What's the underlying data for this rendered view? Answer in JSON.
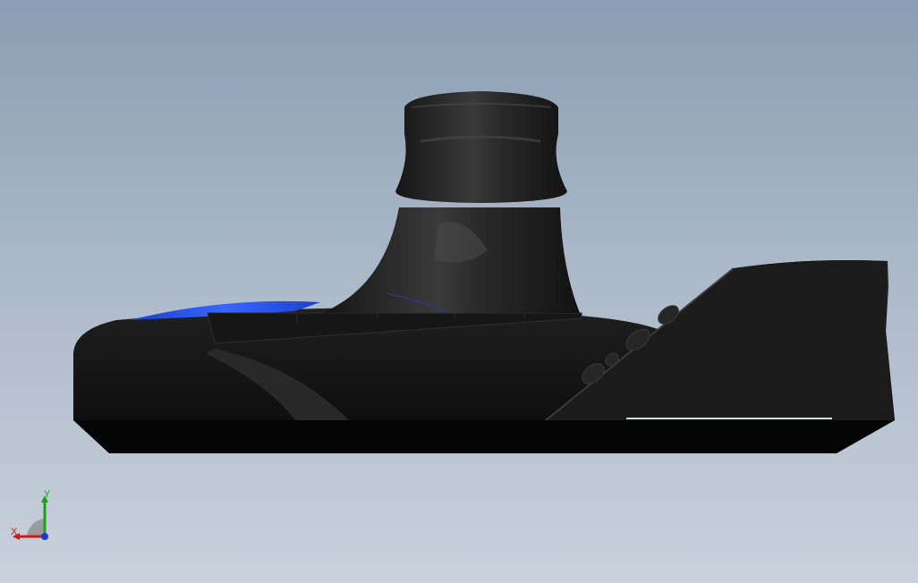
{
  "viewport": {
    "background_top": "#8a9db2",
    "background_bottom": "#c9d1dc"
  },
  "model": {
    "body_color": "#1c1c1c",
    "highlight_color": "#3a3a3a",
    "accent_color": "#1f4fe0"
  },
  "triad": {
    "x_label": "X",
    "y_label": "Y",
    "x_color": "#d01818",
    "y_color": "#1aa21a",
    "z_color": "#1a3ad0"
  }
}
